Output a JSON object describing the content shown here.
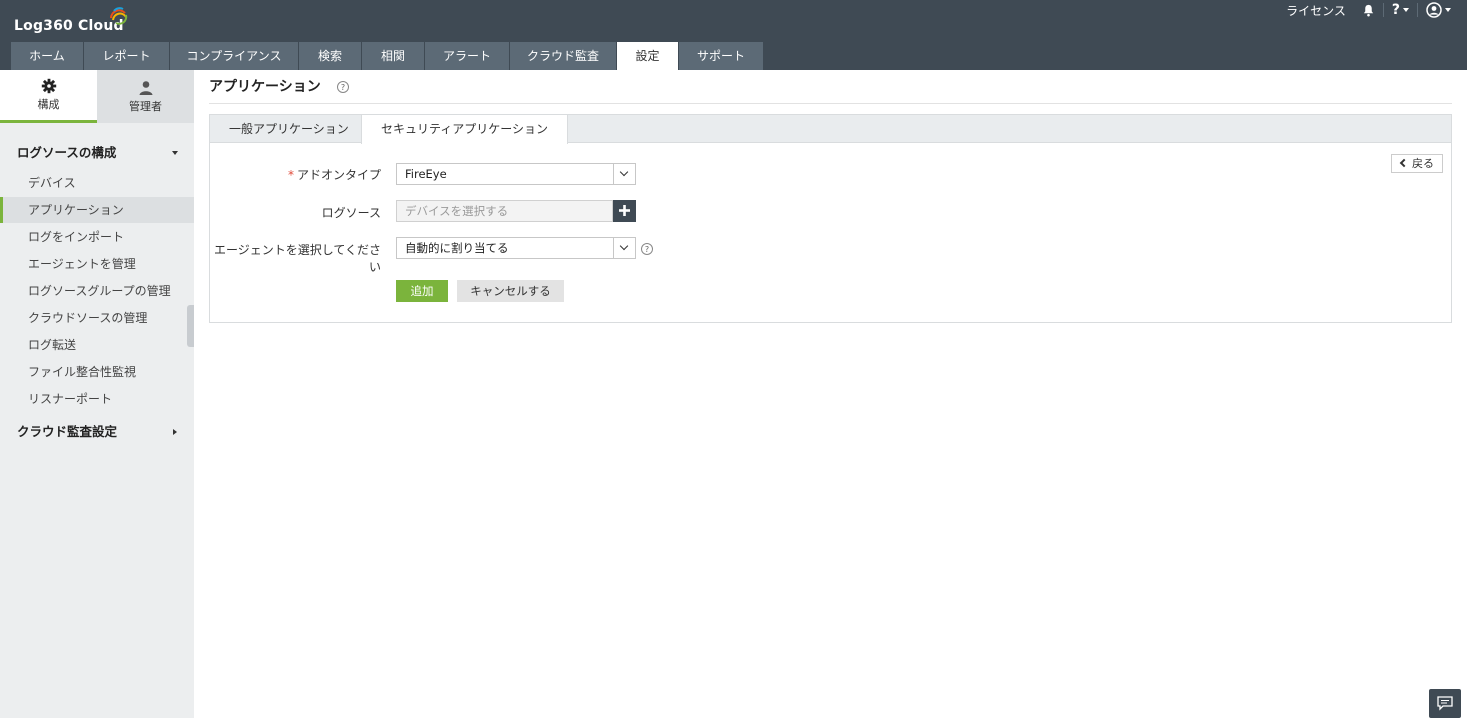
{
  "app": {
    "logo_text": "Log360 Cloud"
  },
  "header": {
    "license_label": "ライセンス",
    "help_label": "?"
  },
  "nav": {
    "tabs": [
      {
        "label": "ホーム"
      },
      {
        "label": "レポート"
      },
      {
        "label": "コンプライアンス"
      },
      {
        "label": "検索"
      },
      {
        "label": "相関"
      },
      {
        "label": "アラート"
      },
      {
        "label": "クラウド監査"
      },
      {
        "label": "設定",
        "active": true
      },
      {
        "label": "サポート"
      }
    ]
  },
  "sidebar": {
    "tabs": [
      {
        "label": "構成",
        "icon": "gear-icon",
        "active": true
      },
      {
        "label": "管理者",
        "icon": "user-icon"
      }
    ],
    "section1": {
      "label": "ログソースの構成"
    },
    "items": [
      {
        "label": "デバイス"
      },
      {
        "label": "アプリケーション",
        "active": true
      },
      {
        "label": "ログをインポート"
      },
      {
        "label": "エージェントを管理"
      },
      {
        "label": "ログソースグループの管理"
      },
      {
        "label": "クラウドソースの管理"
      },
      {
        "label": "ログ転送"
      },
      {
        "label": "ファイル整合性監視"
      },
      {
        "label": "リスナーポート"
      }
    ],
    "section2": {
      "label": "クラウド監査設定"
    }
  },
  "main": {
    "title": "アプリケーション",
    "tabs": [
      {
        "label": "一般アプリケーション"
      },
      {
        "label": "セキュリティアプリケーション",
        "active": true
      }
    ],
    "back_label": "戻る",
    "form": {
      "addon_type": {
        "required_mark": "*",
        "label": "アドオンタイプ",
        "value": "FireEye"
      },
      "log_source": {
        "label": "ログソース",
        "placeholder": "デバイスを選択する"
      },
      "agent": {
        "label": "エージェントを選択してください",
        "value": "自動的に割り当てる"
      }
    },
    "add_label": "追加",
    "cancel_label": "キャンセルする"
  },
  "colors": {
    "header_bg": "#3f4a54",
    "tab_bg": "#5c6a76",
    "accent_green": "#7bb43c",
    "required_red": "#e04b3a"
  }
}
